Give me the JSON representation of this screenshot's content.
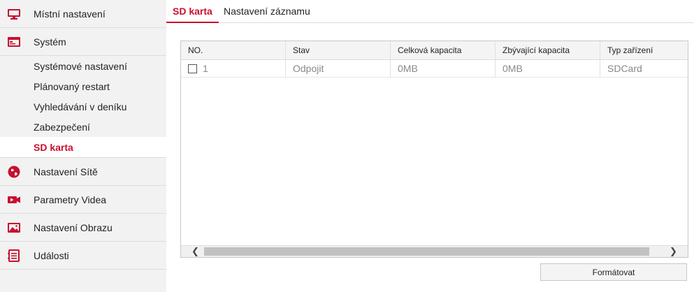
{
  "sidebar": {
    "items": [
      {
        "label": "Místní nastavení",
        "icon": "monitor-icon"
      },
      {
        "label": "Systém",
        "icon": "system-icon"
      },
      {
        "label": "Nastavení Sítě",
        "icon": "globe-icon"
      },
      {
        "label": "Parametry Videa",
        "icon": "video-icon"
      },
      {
        "label": "Nastavení Obrazu",
        "icon": "image-icon"
      },
      {
        "label": "Události",
        "icon": "events-icon"
      }
    ],
    "system_subitems": [
      "Systémové nastavení",
      "Plánovaný restart",
      "Vyhledávání v deníku",
      "Zabezpečení",
      "SD karta"
    ],
    "active_subitem": "SD karta"
  },
  "tabs": [
    {
      "label": "SD karta",
      "active": true
    },
    {
      "label": "Nastavení záznamu",
      "active": false
    }
  ],
  "table": {
    "columns": [
      "NO.",
      "Stav",
      "Celková kapacita",
      "Zbývající kapacita",
      "Typ zařízení"
    ],
    "rows": [
      {
        "no": "1",
        "stav": "Odpojit",
        "celkova": "0MB",
        "zbyvajici": "0MB",
        "typ": "SDCard",
        "checked": false
      }
    ]
  },
  "buttons": {
    "format": "Formátovat"
  },
  "colors": {
    "accent": "#c8102e",
    "sidebar_bg": "#f2f2f2"
  }
}
